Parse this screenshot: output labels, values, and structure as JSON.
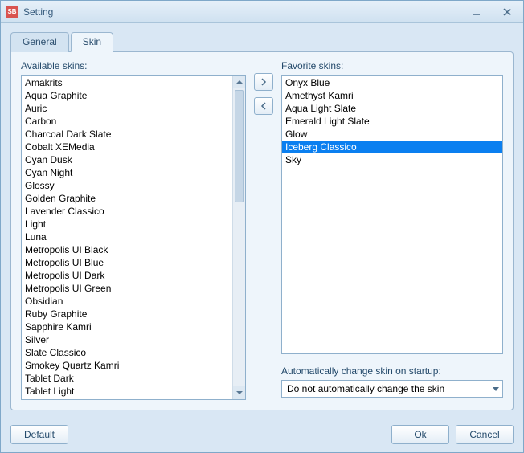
{
  "app_icon_text": "SB",
  "window_title": "Setting",
  "tabs": [
    {
      "label": "General",
      "active": false
    },
    {
      "label": "Skin",
      "active": true
    }
  ],
  "available_label": "Available skins:",
  "favorite_label": "Favorite skins:",
  "available_skins": [
    "Amakrits",
    "Aqua Graphite",
    "Auric",
    "Carbon",
    "Charcoal Dark Slate",
    "Cobalt XEMedia",
    "Cyan Dusk",
    "Cyan Night",
    "Glossy",
    "Golden Graphite",
    "Lavender Classico",
    "Light",
    "Luna",
    "Metropolis UI Black",
    "Metropolis UI Blue",
    "Metropolis UI Dark",
    "Metropolis UI Green",
    "Obsidian",
    "Ruby Graphite",
    "Sapphire Kamri",
    "Silver",
    "Slate Classico",
    "Smokey Quartz Kamri",
    "Tablet Dark",
    "Tablet Light"
  ],
  "favorite_skins": [
    {
      "label": "Onyx Blue",
      "selected": false
    },
    {
      "label": "Amethyst Kamri",
      "selected": false
    },
    {
      "label": "Aqua Light Slate",
      "selected": false
    },
    {
      "label": "Emerald Light Slate",
      "selected": false
    },
    {
      "label": "Glow",
      "selected": false
    },
    {
      "label": "Iceberg Classico",
      "selected": true
    },
    {
      "label": "Sky",
      "selected": false
    }
  ],
  "auto_change_label": "Automatically change skin on startup:",
  "auto_change_value": "Do not automatically change the skin",
  "buttons": {
    "default": "Default",
    "ok": "Ok",
    "cancel": "Cancel"
  }
}
